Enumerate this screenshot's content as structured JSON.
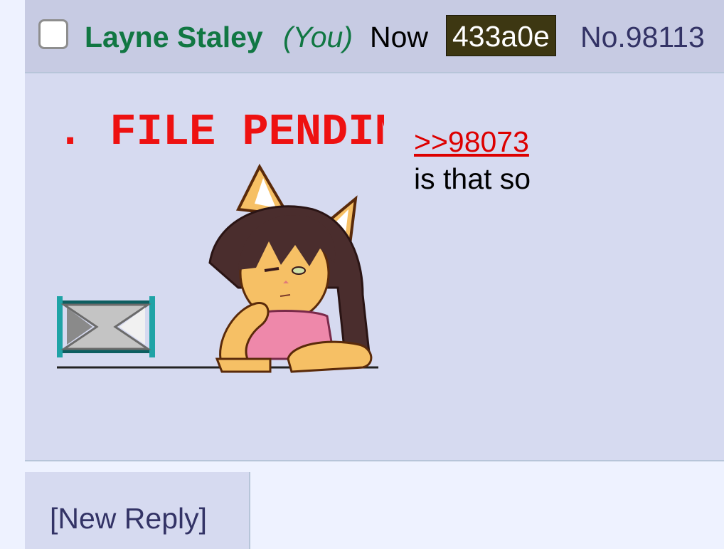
{
  "post": {
    "name": "Layne Staley",
    "you_label": "(You)",
    "time": "Now",
    "poster_id": "433a0e",
    "post_number": "No.98113",
    "quote_link": ">>98073",
    "comment": "is that so"
  },
  "image": {
    "banner_text": ". FILE PENDIN"
  },
  "actions": {
    "new_reply": "[New Reply]"
  }
}
